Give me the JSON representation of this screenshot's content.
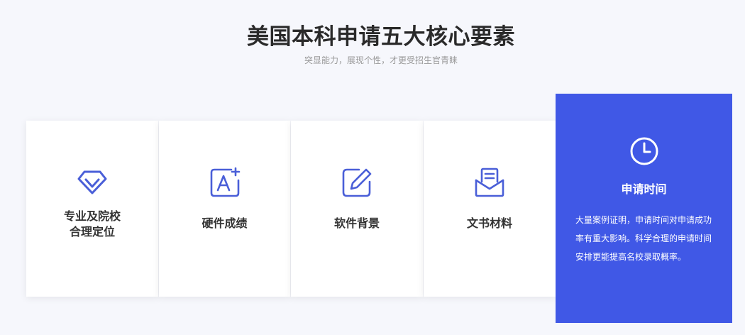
{
  "header": {
    "title": "美国本科申请五大核心要素",
    "subtitle": "突显能力，展现个性，才更受招生官青睐"
  },
  "cards": [
    {
      "label_line1": "专业及院校",
      "label_line2": "合理定位",
      "icon": "diamond-icon"
    },
    {
      "label": "硬件成绩",
      "icon": "grade-a-plus-icon"
    },
    {
      "label": "软件背景",
      "icon": "edit-pencil-icon"
    },
    {
      "label": "文书材料",
      "icon": "document-envelope-icon"
    },
    {
      "label": "申请时间",
      "icon": "clock-icon",
      "active": true,
      "description": "大量案例证明，申请时间对申请成功率有重大影响。科学合理的申请时间安排更能提高名校录取概率。"
    }
  ],
  "colors": {
    "accent": "#4058e6",
    "icon": "#4a5fd8",
    "background": "#f6f7fc",
    "card": "#ffffff",
    "title": "#2a2a2a",
    "subtitle": "#9a9a9a"
  }
}
